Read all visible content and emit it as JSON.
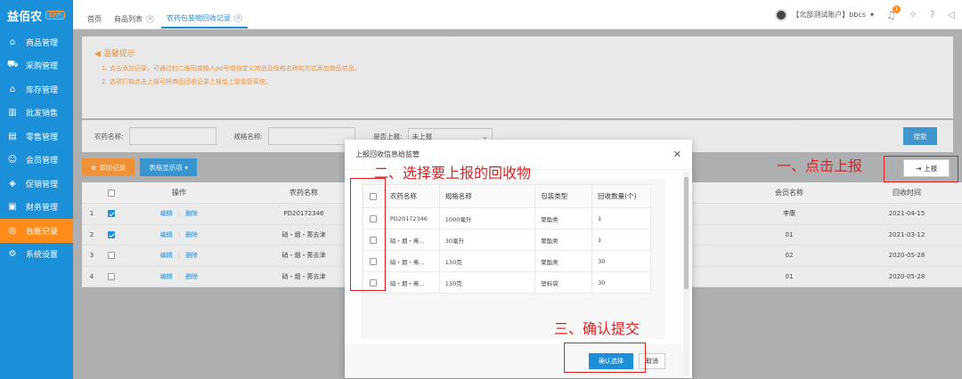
{
  "sidebar": {
    "logo": "益佰农",
    "logo_badge": "ERP",
    "items": [
      {
        "label": "商品管理",
        "icon": "box-icon"
      },
      {
        "label": "采购管理",
        "icon": "cart-icon"
      },
      {
        "label": "库存管理",
        "icon": "home-icon"
      },
      {
        "label": "批发销售",
        "icon": "chart-icon"
      },
      {
        "label": "零售管理",
        "icon": "shop-icon"
      },
      {
        "label": "会员管理",
        "icon": "user-icon"
      },
      {
        "label": "促销管理",
        "icon": "tag-icon"
      },
      {
        "label": "财务管理",
        "icon": "wallet-icon"
      },
      {
        "label": "台账记录",
        "icon": "record-icon",
        "active": true
      },
      {
        "label": "系统设置",
        "icon": "gear-icon"
      }
    ]
  },
  "topbar": {
    "tabs": [
      {
        "label": "首页"
      },
      {
        "label": "商品列表"
      },
      {
        "label": "农药包装物回收记录"
      }
    ],
    "user": "【北部测试账户】bbcs",
    "bell_count": "1"
  },
  "tips": {
    "title": "温馨提示",
    "lines": [
      "1. 点击添加记录，可通过扫二维码或输入pd号或自定义商品及规格名称的方式添加商品信息。",
      "2. 选项打钩点击上报可将商品回收记录上报给上级监管系统。"
    ]
  },
  "filter": {
    "pesticide_label": "农药名称:",
    "spec_label": "规格名称:",
    "reported_label": "是否上报:",
    "reported_value": "未上报",
    "search": "搜索"
  },
  "toolbar": {
    "add": "添加记录",
    "columns": "表格显示项",
    "report": "上报"
  },
  "table": {
    "headers": [
      "",
      "操作",
      "农药名称",
      "会员名称",
      "回收时间"
    ],
    "edit": "编辑",
    "delete": "删除",
    "rows": [
      {
        "n": "1",
        "checked": true,
        "name": "PD20172346",
        "member": "李康",
        "date": "2021-04-15"
      },
      {
        "n": "2",
        "checked": true,
        "name": "硝・烟・莠去津",
        "member": "01",
        "date": "2021-03-12"
      },
      {
        "n": "3",
        "checked": false,
        "name": "硝・烟・莠去津",
        "member": "02",
        "date": "2020-05-28"
      },
      {
        "n": "4",
        "checked": false,
        "name": "硝・烟・莠去津",
        "member": "01",
        "date": "2020-05-28"
      }
    ]
  },
  "modal": {
    "title": "上报回收信息给监管",
    "headers": [
      "农药名称",
      "规格名称",
      "包装类型",
      "回收数量(个)"
    ],
    "rows": [
      {
        "name": "PD20172346",
        "spec": "1000毫升",
        "pack": "聚酯类",
        "qty": "1"
      },
      {
        "name": "硝・烟・莠…",
        "spec": "30毫升",
        "pack": "聚酯类",
        "qty": "1"
      },
      {
        "name": "硝・烟・莠…",
        "spec": "130克",
        "pack": "聚酯类",
        "qty": "30"
      },
      {
        "name": "硝・烟・莠…",
        "spec": "130克",
        "pack": "塑料袋",
        "qty": "30"
      }
    ],
    "confirm": "确认选择",
    "cancel": "取消"
  },
  "annotations": {
    "step1": "一、点击上报",
    "step2": "二、选择要上报的回收物",
    "step3": "三、确认提交"
  }
}
